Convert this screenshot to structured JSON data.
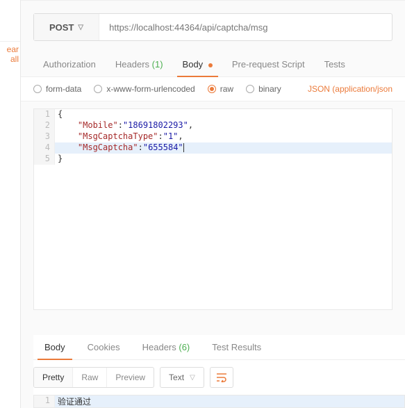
{
  "left": {
    "clear": "ear all"
  },
  "request": {
    "method": "POST",
    "url": "https://localhost:44364/api/captcha/msg"
  },
  "tabs": {
    "auth": "Authorization",
    "headers": "Headers",
    "headers_count": "(1)",
    "body": "Body",
    "prs": "Pre-request Script",
    "tests": "Tests"
  },
  "bodyTypes": {
    "form": "form-data",
    "urlencoded": "x-www-form-urlencoded",
    "raw": "raw",
    "binary": "binary",
    "format": "JSON (application/json"
  },
  "editor": {
    "lines": [
      {
        "n": 1,
        "kind": "open"
      },
      {
        "n": 2,
        "key": "Mobile",
        "val": "18691802293",
        "comma": true
      },
      {
        "n": 3,
        "key": "MsgCaptchaType",
        "val": "1",
        "comma": true
      },
      {
        "n": 4,
        "key": "MsgCaptcha",
        "val": "655584",
        "comma": false,
        "hl": true
      },
      {
        "n": 5,
        "kind": "close"
      }
    ]
  },
  "response": {
    "tabs": {
      "body": "Body",
      "cookies": "Cookies",
      "headers": "Headers",
      "headers_count": "(6)",
      "tests": "Test Results"
    },
    "view": {
      "pretty": "Pretty",
      "raw": "Raw",
      "preview": "Preview",
      "type": "Text"
    },
    "line1": "验证通过"
  }
}
